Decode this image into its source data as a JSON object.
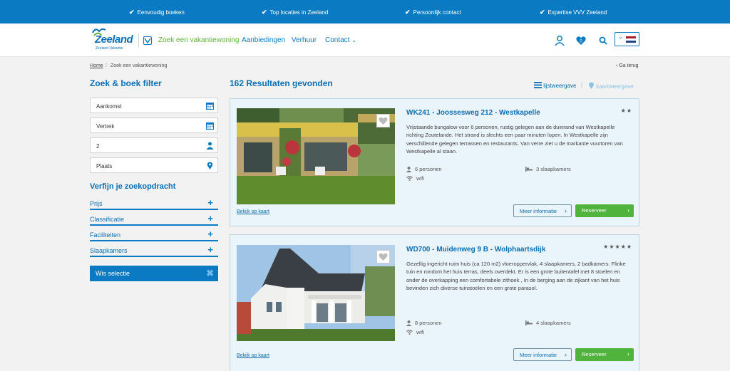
{
  "usps": [
    "Eenvoudig boeken",
    "Top locaties in Zeeland",
    "Persoonlijk contact",
    "Expertise VVV Zeeland"
  ],
  "logo": {
    "word": "Zeeland",
    "sub": "Zeeland Vakantie"
  },
  "nav": {
    "search": "Zoek een vakantiewoning",
    "offers": "Aanbiedingen",
    "rent": "Verhuur",
    "contact": "Contact"
  },
  "header_icons": {
    "account": "user-icon",
    "favorites": "heart-icon",
    "favorites_count": "0",
    "search": "search-icon",
    "language": "dutch-flag-icon"
  },
  "breadcrumb": {
    "home": "Home",
    "sep": "/",
    "current": "Zoek een vakantiewoning",
    "back": "Ga terug"
  },
  "sidebar": {
    "title": "Zoek & boek filter",
    "fields": [
      {
        "label": "Aankomst",
        "icon": "calendar-icon"
      },
      {
        "label": "Vertrek",
        "icon": "calendar-icon"
      },
      {
        "label": "2",
        "icon": "person-icon"
      },
      {
        "label": "Plaats",
        "icon": "map-pin-icon"
      }
    ],
    "refine_title": "Verfijn je zoekopdracht",
    "filters": [
      "Prijs",
      "Classificatie",
      "Faciliteiten",
      "Slaapkamers"
    ],
    "clear": "Wis selectie"
  },
  "results": {
    "count_title": "162 Resultaten gevonden",
    "list_view": "lijstweergave",
    "map_view": "kaartweergave",
    "items": [
      {
        "title": "WK241 - Joossesweg 212 - Westkapelle",
        "stars": "★★",
        "desc": "Vrijstaande bungalow voor 6 personen, rustig gelegen aan de duinrand van Westkapelle richting Zoutelande. Het strand is slechts een paar minuten lopen. In Westkapelle zijn verschillende gelegen terrassen en restaurants. Van verre ziet u de markante vuurtoren van Westkapelle al staan.",
        "persons": "6 personen",
        "bedrooms": "3 slaapkamers",
        "wifi": "wifi",
        "map_link": "Bekijk op kaart",
        "more": "Meer informatie",
        "book": "Reserveer"
      },
      {
        "title": "WD700 - Muidenweg 9 B - Wolphaartsdijk",
        "stars": "★★★★★",
        "desc": "Gezellig ingericht ruim huis (ca 120 m2) vloeroppervlak, 4 slaapkamers, 2 badkamers. Flinke tuin en rondom het huis terras, deels overdekt. Er is een grote buitentafel met 8 stoelen en onder de overkapping een comfortabele zithoek , In de berging aan de zijkant van het huis bevinden zich diverse tuinstoelen en een grote parasol.",
        "persons": "8 personen",
        "bedrooms": "4 slaapkamers",
        "wifi": "wifi",
        "map_link": "Bekijk op kaart",
        "more": "Meer informatie",
        "book": "Reserveer"
      }
    ]
  },
  "colors": {
    "primary": "#0a7bc2",
    "accent_green": "#5fb336",
    "book_green": "#4fb33c",
    "card_bg": "#eaf4fb"
  }
}
